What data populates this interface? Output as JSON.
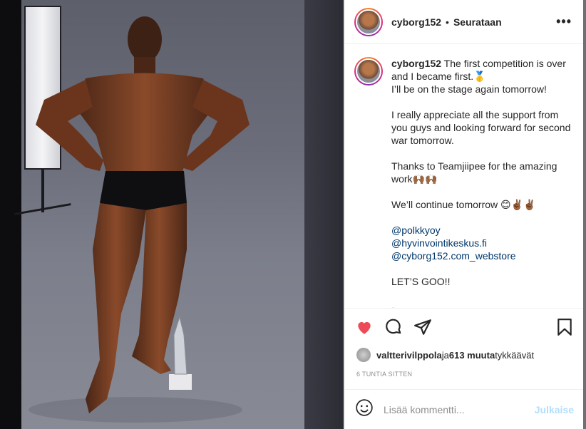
{
  "post": {
    "username": "cyborg152",
    "follow_status": "Seurataan",
    "more_label": "•••"
  },
  "caption": {
    "username": "cyborg152",
    "line1": " The first competition is over and I became first.🥇",
    "line2": "I’ll be on the stage again tomorrow!",
    "line3": "I really appreciate all the support from you guys and looking forward for second war tomorrow.",
    "line4": "Thanks to Teamjiipee for the amazing work🙌🏾🙌🏾",
    "line5": "We’ll continue tomorrow 😊✌🏾✌🏾",
    "mentions": [
      "@polkkyoy",
      "@hyvinvointikeskus.fi",
      "@cyborg152.com_webstore"
    ],
    "line6": "LET’S GOO!!",
    "line7": "-"
  },
  "likes": {
    "user": "valtterivilppola",
    "connector": " ja ",
    "others": "613 muuta",
    "suffix": " tykkäävät"
  },
  "timestamp": "6 TUNTIA SITTEN",
  "comment": {
    "placeholder": "Lisää kommentti...",
    "post_label": "Julkaise"
  },
  "colors": {
    "like_red": "#ed4956",
    "link_blue": "#00376b",
    "post_disabled": "#b2dffc"
  },
  "icons": [
    "heart-icon",
    "comment-icon",
    "share-icon",
    "bookmark-icon",
    "emoji-icon"
  ]
}
